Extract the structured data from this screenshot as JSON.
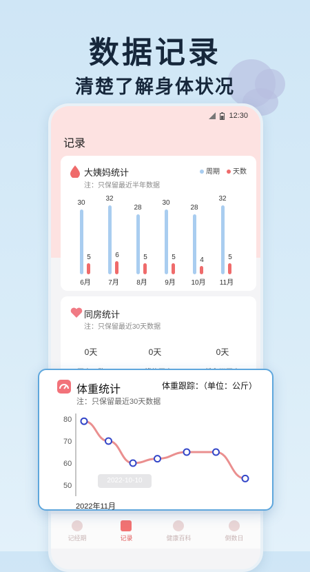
{
  "headline": {
    "title": "数据记录",
    "subtitle": "清楚了解身体状况"
  },
  "status_bar": {
    "time": "12:30"
  },
  "page_title": "记录",
  "period_card": {
    "title": "大姨妈统计",
    "note": "注：只保留最近半年数据",
    "legend": {
      "cycle": "周期",
      "days": "天数"
    },
    "colors": {
      "cycle": "#a9cdf0",
      "days": "#ef6b6b"
    }
  },
  "chart_data": [
    {
      "type": "bar",
      "categories": [
        "6月",
        "7月",
        "8月",
        "9月",
        "10月",
        "11月"
      ],
      "series": [
        {
          "name": "周期",
          "values": [
            30,
            32,
            28,
            30,
            28,
            32
          ]
        },
        {
          "name": "天数",
          "values": [
            5,
            6,
            5,
            5,
            4,
            5
          ]
        }
      ],
      "title": "大姨妈统计",
      "ylim": [
        0,
        32
      ],
      "legend": "top-right"
    },
    {
      "type": "line",
      "x": [
        "",
        "",
        "",
        "",
        "",
        "",
        ""
      ],
      "values": [
        79,
        70,
        60,
        62,
        65,
        65,
        53
      ],
      "ylim": [
        45,
        82
      ],
      "yticks": [
        "80",
        "70",
        "60",
        "50"
      ],
      "xlabel": "2022年11月",
      "title": "体重统计"
    }
  ],
  "intimacy_card": {
    "title": "同房统计",
    "note": "注：只保留最近30天数据",
    "stats": [
      {
        "value": "0天",
        "label": "同房天数"
      },
      {
        "value": "0天",
        "label": "无措施同房"
      },
      {
        "value": "0天",
        "label": "排卵期同房"
      }
    ]
  },
  "weight_card": {
    "title": "体重统计",
    "tracking": "体重跟踪：（单位：公斤）",
    "note": "注：只保留最近30天数据",
    "tooltip": "2022-10-10",
    "month": "2022年11月",
    "line_color": "#ea8f8f",
    "point_color": "#3346c8"
  },
  "tabs": [
    {
      "label": "记经期",
      "icon": "drop-icon",
      "active": false
    },
    {
      "label": "记录",
      "icon": "note-icon",
      "active": true
    },
    {
      "label": "健康百科",
      "icon": "heart-monitor-icon",
      "active": false
    },
    {
      "label": "倒数日",
      "icon": "clock-icon",
      "active": false
    }
  ]
}
